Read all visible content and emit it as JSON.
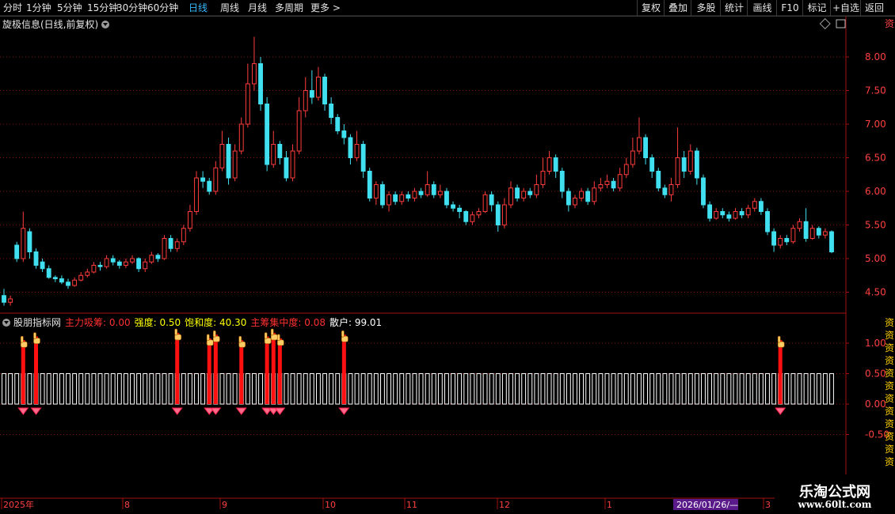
{
  "toolbar": {
    "timeframes": [
      "分时",
      "1分钟",
      "5分钟",
      "15分钟",
      "30分钟",
      "60分钟",
      "日线",
      "周线",
      "月线",
      "多周期",
      "更多 >"
    ],
    "active": "日线",
    "right_buttons": [
      "复权",
      "叠加",
      "多股",
      "统计",
      "画线",
      "F10",
      "标记",
      "+自选",
      "返回"
    ]
  },
  "main_title": "旋极信息(日线,前复权)",
  "price_axis": [
    "8.00",
    "7.50",
    "7.00",
    "6.50",
    "6.00",
    "5.50",
    "5.00",
    "4.50"
  ],
  "indicator": {
    "name": "股朋指标网",
    "fields": [
      {
        "label": "主力吸筹: 0.00",
        "color": "#ff3030"
      },
      {
        "label": "强度: 0.50",
        "color": "#ffff00"
      },
      {
        "label": "饱和度: 40.30",
        "color": "#ffff00"
      },
      {
        "label": "主筹集中度: 0.08",
        "color": "#ff3030"
      },
      {
        "label": "散户: 99.01",
        "color": "#ffffff"
      }
    ],
    "axis": [
      "1.00",
      "0.50",
      "0.00",
      "-0.50"
    ]
  },
  "date_axis": {
    "labels": [
      "2025年",
      "8",
      "9",
      "10",
      "11",
      "12",
      "1",
      "3"
    ],
    "highlight": "2026/01/26/—"
  },
  "right_strip_text": "资资资资资资资开资资资资资资资开资资资资资资资",
  "right_strip_text2": "资资资资资资资资资资资资",
  "watermark": {
    "line1": "乐淘公式网",
    "line2": "www.60lt.com"
  },
  "chart_data": {
    "type": "candlestick",
    "title": "旋极信息(日线,前复权)",
    "ylim": [
      4.2,
      8.4
    ],
    "candles": [
      [
        4.45,
        4.35,
        4.55,
        4.3
      ],
      [
        4.35,
        4.4,
        4.45,
        4.3
      ],
      [
        5.2,
        5.0,
        5.25,
        4.95
      ],
      [
        5.0,
        5.45,
        5.7,
        4.95
      ],
      [
        5.4,
        5.1,
        5.45,
        5.0
      ],
      [
        5.1,
        4.9,
        5.15,
        4.85
      ],
      [
        4.95,
        4.85,
        5.0,
        4.8
      ],
      [
        4.85,
        4.72,
        4.9,
        4.7
      ],
      [
        4.72,
        4.7,
        4.75,
        4.65
      ],
      [
        4.7,
        4.65,
        4.75,
        4.62
      ],
      [
        4.65,
        4.6,
        4.7,
        4.55
      ],
      [
        4.6,
        4.68,
        4.72,
        4.58
      ],
      [
        4.68,
        4.75,
        4.8,
        4.66
      ],
      [
        4.75,
        4.8,
        4.85,
        4.72
      ],
      [
        4.8,
        4.9,
        4.95,
        4.78
      ],
      [
        4.9,
        4.88,
        4.95,
        4.82
      ],
      [
        4.88,
        5.0,
        5.05,
        4.85
      ],
      [
        5.0,
        4.95,
        5.05,
        4.9
      ],
      [
        4.95,
        4.9,
        4.98,
        4.85
      ],
      [
        4.9,
        4.95,
        5.0,
        4.86
      ],
      [
        4.95,
        5.0,
        5.05,
        4.92
      ],
      [
        5.0,
        4.85,
        5.02,
        4.8
      ],
      [
        4.85,
        4.95,
        5.0,
        4.8
      ],
      [
        4.95,
        5.05,
        5.1,
        4.92
      ],
      [
        5.05,
        5.0,
        5.08,
        4.95
      ],
      [
        5.0,
        5.3,
        5.35,
        4.98
      ],
      [
        5.3,
        5.15,
        5.35,
        5.1
      ],
      [
        5.15,
        5.25,
        5.3,
        5.1
      ],
      [
        5.25,
        5.45,
        5.5,
        5.2
      ],
      [
        5.45,
        5.7,
        5.8,
        5.4
      ],
      [
        5.7,
        6.2,
        6.3,
        5.65
      ],
      [
        6.2,
        6.15,
        6.3,
        6.05
      ],
      [
        6.15,
        6.0,
        6.2,
        5.95
      ],
      [
        6.0,
        6.35,
        6.45,
        5.95
      ],
      [
        6.35,
        6.7,
        6.9,
        6.3
      ],
      [
        6.7,
        6.2,
        6.8,
        6.1
      ],
      [
        6.2,
        6.6,
        6.7,
        6.15
      ],
      [
        6.6,
        7.0,
        7.1,
        6.55
      ],
      [
        7.0,
        7.6,
        7.9,
        6.95
      ],
      [
        7.6,
        7.9,
        8.3,
        7.5
      ],
      [
        7.9,
        7.3,
        8.0,
        7.2
      ],
      [
        7.3,
        6.4,
        7.4,
        6.3
      ],
      [
        6.4,
        6.7,
        6.9,
        6.35
      ],
      [
        6.7,
        6.5,
        6.75,
        6.4
      ],
      [
        6.5,
        6.2,
        6.6,
        6.15
      ],
      [
        6.2,
        6.6,
        6.7,
        6.15
      ],
      [
        6.6,
        7.2,
        7.4,
        6.55
      ],
      [
        7.2,
        7.5,
        7.7,
        7.1
      ],
      [
        7.5,
        7.4,
        7.8,
        7.3
      ],
      [
        7.4,
        7.7,
        7.85,
        7.35
      ],
      [
        7.7,
        7.3,
        7.75,
        7.2
      ],
      [
        7.3,
        7.1,
        7.4,
        7.0
      ],
      [
        7.1,
        6.9,
        7.15,
        6.85
      ],
      [
        6.9,
        6.8,
        7.0,
        6.7
      ],
      [
        6.8,
        6.5,
        6.85,
        6.4
      ],
      [
        6.5,
        6.7,
        6.9,
        6.45
      ],
      [
        6.7,
        6.3,
        6.75,
        6.2
      ],
      [
        6.3,
        5.9,
        6.35,
        5.85
      ],
      [
        5.9,
        6.1,
        6.15,
        5.8
      ],
      [
        6.1,
        5.8,
        6.15,
        5.75
      ],
      [
        5.8,
        5.95,
        6.0,
        5.7
      ],
      [
        5.95,
        5.85,
        6.0,
        5.8
      ],
      [
        5.85,
        5.95,
        6.0,
        5.8
      ],
      [
        5.95,
        5.9,
        6.0,
        5.85
      ],
      [
        5.9,
        6.0,
        6.05,
        5.85
      ],
      [
        6.0,
        5.95,
        6.05,
        5.9
      ],
      [
        5.95,
        6.1,
        6.3,
        5.92
      ],
      [
        6.1,
        5.95,
        6.15,
        5.9
      ],
      [
        5.95,
        6.0,
        6.1,
        5.9
      ],
      [
        6.0,
        5.8,
        6.05,
        5.75
      ],
      [
        5.8,
        5.75,
        5.85,
        5.7
      ],
      [
        5.75,
        5.7,
        5.8,
        5.6
      ],
      [
        5.7,
        5.55,
        5.72,
        5.5
      ],
      [
        5.55,
        5.65,
        5.7,
        5.5
      ],
      [
        5.65,
        5.7,
        5.75,
        5.6
      ],
      [
        5.7,
        5.95,
        6.0,
        5.68
      ],
      [
        5.95,
        5.8,
        6.0,
        5.7
      ],
      [
        5.8,
        5.5,
        5.85,
        5.4
      ],
      [
        5.5,
        5.8,
        5.9,
        5.45
      ],
      [
        5.8,
        6.05,
        6.15,
        5.75
      ],
      [
        6.05,
        5.9,
        6.1,
        5.85
      ],
      [
        5.9,
        6.0,
        6.05,
        5.85
      ],
      [
        6.0,
        5.95,
        6.05,
        5.9
      ],
      [
        5.95,
        6.1,
        6.25,
        5.9
      ],
      [
        6.1,
        6.3,
        6.5,
        6.05
      ],
      [
        6.3,
        6.5,
        6.6,
        6.25
      ],
      [
        6.5,
        6.3,
        6.55,
        6.2
      ],
      [
        6.3,
        6.0,
        6.35,
        5.9
      ],
      [
        6.0,
        5.8,
        6.05,
        5.7
      ],
      [
        5.8,
        5.9,
        5.95,
        5.75
      ],
      [
        5.9,
        6.0,
        6.05,
        5.85
      ],
      [
        6.0,
        5.85,
        6.05,
        5.8
      ],
      [
        5.85,
        6.05,
        6.15,
        5.8
      ],
      [
        6.05,
        6.1,
        6.2,
        6.0
      ],
      [
        6.1,
        6.15,
        6.25,
        6.05
      ],
      [
        6.15,
        6.05,
        6.2,
        6.0
      ],
      [
        6.05,
        6.25,
        6.35,
        6.0
      ],
      [
        6.25,
        6.4,
        6.5,
        6.2
      ],
      [
        6.4,
        6.6,
        6.8,
        6.35
      ],
      [
        6.6,
        6.8,
        7.1,
        6.55
      ],
      [
        6.8,
        6.5,
        6.85,
        6.4
      ],
      [
        6.5,
        6.3,
        6.55,
        6.2
      ],
      [
        6.3,
        6.05,
        6.35,
        6.0
      ],
      [
        6.05,
        5.95,
        6.1,
        5.9
      ],
      [
        5.95,
        6.1,
        6.2,
        5.85
      ],
      [
        6.1,
        6.5,
        6.95,
        6.05
      ],
      [
        6.5,
        6.3,
        6.6,
        6.2
      ],
      [
        6.3,
        6.6,
        6.7,
        6.25
      ],
      [
        6.6,
        6.2,
        6.65,
        6.1
      ],
      [
        6.2,
        5.8,
        6.25,
        5.75
      ],
      [
        5.8,
        5.6,
        5.85,
        5.55
      ],
      [
        5.6,
        5.7,
        5.75,
        5.58
      ],
      [
        5.7,
        5.65,
        5.75,
        5.6
      ],
      [
        5.65,
        5.6,
        5.7,
        5.55
      ],
      [
        5.6,
        5.7,
        5.75,
        5.58
      ],
      [
        5.7,
        5.65,
        5.75,
        5.6
      ],
      [
        5.65,
        5.75,
        5.8,
        5.6
      ],
      [
        5.75,
        5.85,
        5.9,
        5.7
      ],
      [
        5.85,
        5.7,
        5.9,
        5.65
      ],
      [
        5.7,
        5.4,
        5.75,
        5.35
      ],
      [
        5.4,
        5.2,
        5.45,
        5.1
      ],
      [
        5.2,
        5.3,
        5.35,
        5.15
      ],
      [
        5.3,
        5.25,
        5.35,
        5.2
      ],
      [
        5.25,
        5.45,
        5.5,
        5.22
      ],
      [
        5.45,
        5.55,
        5.6,
        5.4
      ],
      [
        5.55,
        5.3,
        5.75,
        5.25
      ],
      [
        5.3,
        5.45,
        5.5,
        5.28
      ],
      [
        5.45,
        5.35,
        5.48,
        5.3
      ],
      [
        5.35,
        5.4,
        5.45,
        5.3
      ],
      [
        5.4,
        5.1,
        5.42,
        5.08
      ]
    ],
    "indicator_signal_indices": [
      3,
      5,
      27,
      32,
      33,
      37,
      41,
      42,
      43,
      53,
      121
    ],
    "indicator_bar_value": 0.5
  }
}
